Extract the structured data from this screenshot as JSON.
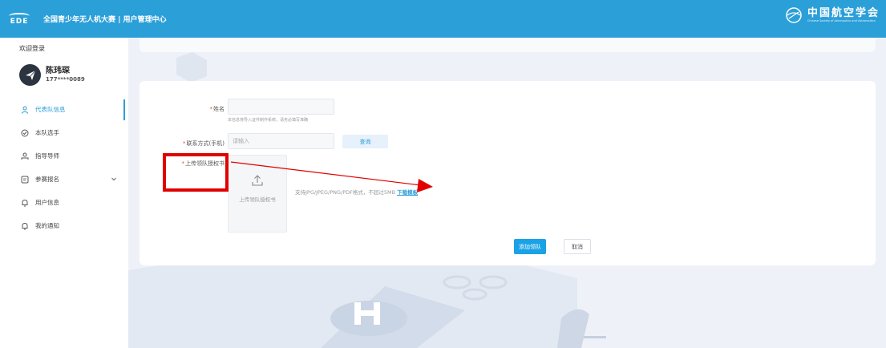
{
  "header": {
    "logo_text": "EDE",
    "title": "全国青少年无人机大赛 | 用户管理中心",
    "brand_cn": "中国航空学会",
    "brand_en": "Chinese Society of Aeronautics and Astronautics"
  },
  "sidebar": {
    "welcome": "欢迎登录",
    "user": {
      "name": "陈玮琛",
      "phone": "177****0089"
    },
    "items": [
      {
        "label": "代表队信息",
        "icon": "user-outline-icon",
        "active": true
      },
      {
        "label": "本队选手",
        "icon": "check-circle-icon"
      },
      {
        "label": "指导导师",
        "icon": "team-icon"
      },
      {
        "label": "参赛报名",
        "icon": "document-icon",
        "has_chevron": true
      },
      {
        "label": "用户信息",
        "icon": "bell-icon"
      },
      {
        "label": "我的通知",
        "icon": "bell-icon"
      }
    ]
  },
  "form": {
    "name_label": "姓名",
    "name_hint": "本信息将导入证件制作系统，请务必填写准确",
    "phone_label": "联系方式(手机)",
    "phone_placeholder": "请输入",
    "query_button": "查询",
    "upload_label": "上传领队授权书",
    "upload_box_text": "上传领队授权书",
    "support_text": "支持JPG/JPEG/PNG/PDF格式，不超过5MB",
    "download_link": "下载模板",
    "add_button": "添加领队",
    "cancel_button": "取消"
  },
  "colors": {
    "accent": "#2b9fd8",
    "primary_button": "#1aa2e6",
    "annotation_red": "#e00000"
  }
}
